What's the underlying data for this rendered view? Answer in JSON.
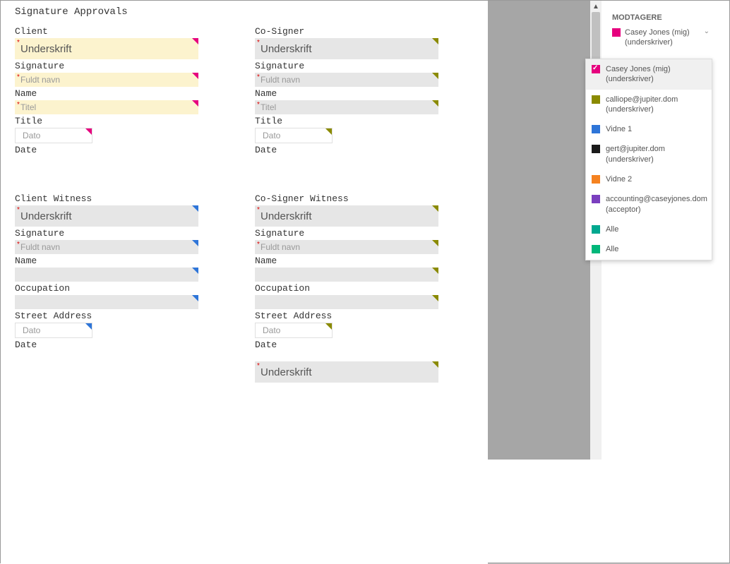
{
  "doc": {
    "title": "Signature Approvals",
    "client": {
      "header": "Client",
      "signature_field": "Underskrift",
      "sig_label": "Signature",
      "name_field": "Fuldt navn",
      "name_label": "Name",
      "title_field": "Titel",
      "title_label": "Title",
      "date_field": "Dato",
      "date_label": "Date"
    },
    "cosigner": {
      "header": "Co-Signer",
      "signature_field": "Underskrift",
      "sig_label": "Signature",
      "name_field": "Fuldt navn",
      "name_label": "Name",
      "title_field": "Titel",
      "title_label": "Title",
      "date_field": "Dato",
      "date_label": "Date"
    },
    "client_witness": {
      "header": "Client Witness",
      "signature_field": "Underskrift",
      "sig_label": "Signature",
      "name_field": "Fuldt navn",
      "name_label": "Name",
      "row3_label": "Occupation",
      "row4_label": "Street Address",
      "date_field": "Dato",
      "date_label": "Date"
    },
    "cosigner_witness": {
      "header": "Co-Signer Witness",
      "signature_field": "Underskrift",
      "sig_label": "Signature",
      "name_field": "Fuldt navn",
      "name_label": "Name",
      "row3_label": "Occupation",
      "row4_label": "Street Address",
      "date_field": "Dato",
      "date_label": "Date",
      "extra_sig": "Underskrift"
    }
  },
  "panel": {
    "header": "MODTAGERE",
    "current": {
      "name": "Casey Jones (mig)",
      "role": "(underskriver)"
    }
  },
  "dropdown": [
    {
      "name": "Casey Jones (mig)",
      "role": "(underskriver)",
      "color": "c-pink",
      "selected": true
    },
    {
      "name": "calliope@jupiter.dom",
      "role": "(underskriver)",
      "color": "c-olive",
      "selected": false
    },
    {
      "name": "Vidne 1",
      "role": "",
      "color": "c-blue",
      "selected": false
    },
    {
      "name": "gert@jupiter.dom",
      "role": "(underskriver)",
      "color": "c-black",
      "selected": false
    },
    {
      "name": "Vidne 2",
      "role": "",
      "color": "c-orange",
      "selected": false
    },
    {
      "name": "accounting@caseyjones.dom",
      "role": "(acceptor)",
      "color": "c-purple",
      "selected": false
    },
    {
      "name": "Alle",
      "role": "",
      "color": "c-teal",
      "selected": false
    },
    {
      "name": "Alle",
      "role": "",
      "color": "c-green",
      "selected": false
    }
  ]
}
